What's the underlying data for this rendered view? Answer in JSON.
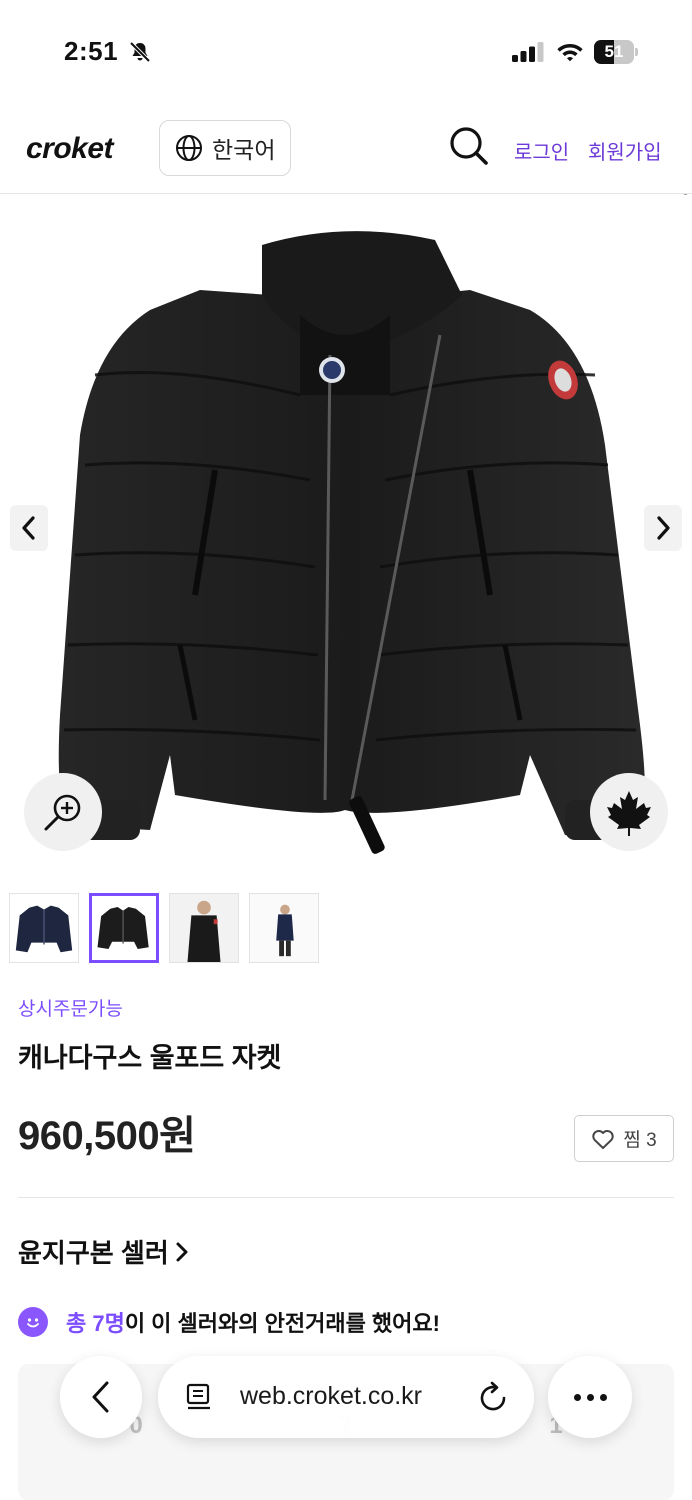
{
  "status_bar": {
    "time": "2:51",
    "battery": "51",
    "battery_level": 0.51
  },
  "header": {
    "logo": "croket",
    "language": "한국어",
    "login": "로그인",
    "signup": "회원가입"
  },
  "product": {
    "tag": "상시주문가능",
    "title": "캐나다구스 울포드 자켓",
    "price": "960,500원",
    "like_label": "찜 3"
  },
  "seller": {
    "name": "윤지구본 셀러",
    "trust_highlight": "총 7명",
    "trust_rest": "이 이 셀러와의 안전거래를 했어요!",
    "stats": [
      {
        "label": "",
        "value": "0"
      },
      {
        "label": "",
        "value": "7"
      },
      {
        "label": "",
        "value": "1"
      }
    ]
  },
  "browser": {
    "url": "web.croket.co.kr"
  },
  "colors": {
    "accent": "#7c4dff",
    "link": "#6c3ad6"
  },
  "icons": [
    "bell-slash-icon",
    "signal-icon",
    "wifi-icon",
    "battery-icon",
    "globe-icon",
    "search-icon",
    "chevron-left-icon",
    "chevron-right-icon",
    "zoom-in-icon",
    "maple-leaf-icon",
    "heart-icon",
    "chevron-right-icon",
    "smile-icon",
    "tabs-icon",
    "reload-icon",
    "more-icon"
  ]
}
